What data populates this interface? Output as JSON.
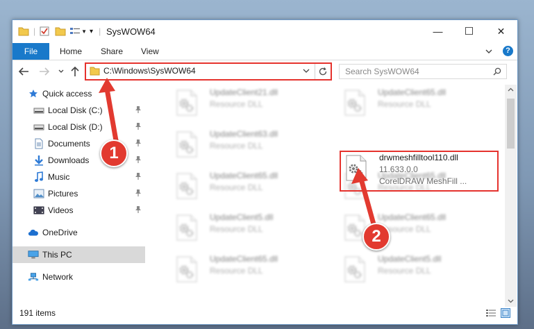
{
  "window": {
    "title": "SysWOW64",
    "controls": {
      "minimize": "—",
      "maximize": "☐",
      "close": "✕"
    }
  },
  "ribbon": {
    "tabs": [
      "File",
      "Home",
      "Share",
      "View"
    ],
    "help": "?"
  },
  "address": {
    "path": "C:\\Windows\\SysWOW64",
    "search_placeholder": "Search SysWOW64"
  },
  "sidebar": {
    "items": [
      {
        "label": "Quick access",
        "icon": "star-icon",
        "pinned": false,
        "sub": false
      },
      {
        "label": "Local Disk (C:)",
        "icon": "drive-icon",
        "pinned": true,
        "sub": true
      },
      {
        "label": "Local Disk (D:)",
        "icon": "drive-icon",
        "pinned": true,
        "sub": true
      },
      {
        "label": "Documents",
        "icon": "documents-icon",
        "pinned": true,
        "sub": true
      },
      {
        "label": "Downloads",
        "icon": "download-icon",
        "pinned": true,
        "sub": true
      },
      {
        "label": "Music",
        "icon": "music-icon",
        "pinned": true,
        "sub": true
      },
      {
        "label": "Pictures",
        "icon": "pictures-icon",
        "pinned": true,
        "sub": true
      },
      {
        "label": "Videos",
        "icon": "videos-icon",
        "pinned": true,
        "sub": true
      },
      {
        "label": "OneDrive",
        "icon": "cloud-icon",
        "pinned": false,
        "sub": false
      },
      {
        "label": "This PC",
        "icon": "computer-icon",
        "pinned": false,
        "sub": false,
        "selected": true
      },
      {
        "label": "Network",
        "icon": "network-icon",
        "pinned": false,
        "sub": false
      }
    ]
  },
  "files": {
    "col1": [
      {
        "name": "UpdateClient21.dll",
        "type": "Resource DLL"
      },
      {
        "name": "UpdateClient63.dll",
        "type": "Resource DLL"
      },
      {
        "name": "UpdateClient65.dll",
        "type": "Resource DLL"
      },
      {
        "name": "UpdateClient5.dll",
        "type": "Resource DLL"
      },
      {
        "name": "UpdateClient65.dll",
        "type": "Resource DLL"
      }
    ],
    "col2": [
      {
        "name": "UpdateClient65.dll",
        "type": "Resource DLL"
      },
      {
        "name": "UpdateClient65.dll",
        "type": "Resource DLL"
      },
      {
        "name": "UpdateClient65.dll",
        "type": "Resource DLL"
      },
      {
        "name": "UpdateClient5.dll",
        "type": "Resource DLL"
      }
    ],
    "highlighted": {
      "name": "drwmeshfilltool110.dll",
      "version": "11.633.0.0",
      "description": "CorelDRAW MeshFill ..."
    }
  },
  "status": {
    "items_count": "191 items"
  },
  "annotations": {
    "badge1": "1",
    "badge2": "2"
  },
  "colors": {
    "accent": "#1979ca",
    "highlight": "#e5322d"
  }
}
